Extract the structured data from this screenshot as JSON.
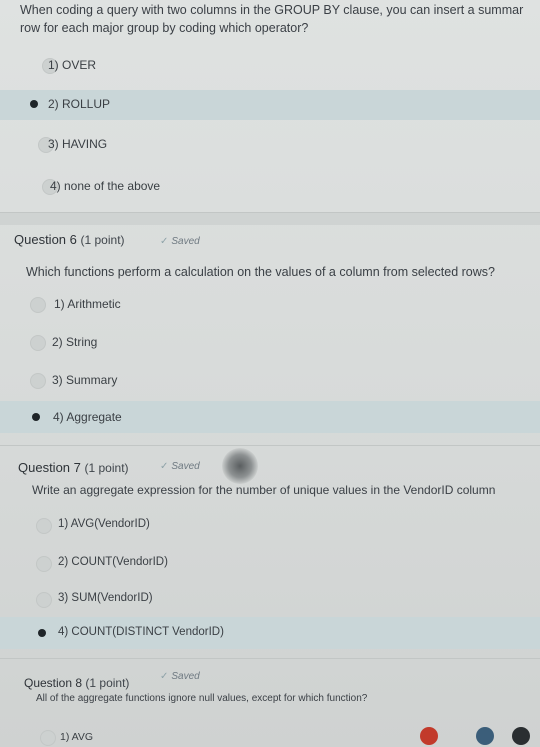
{
  "q5": {
    "question_line1": "When coding a query with two columns in the GROUP BY clause, you can insert a summar",
    "question_line2": "row for each major group by coding which operator?",
    "options": [
      "1) OVER",
      "2) ROLLUP",
      "3) HAVING",
      "4) none of the above"
    ],
    "selected_index": 1
  },
  "q6": {
    "title": "Question 6",
    "points": "(1 point)",
    "saved": "Saved",
    "question": "Which functions perform a calculation on the values of a column from selected rows?",
    "options": [
      "1) Arithmetic",
      "2) String",
      "3) Summary",
      "4) Aggregate"
    ],
    "selected_index": 3
  },
  "q7": {
    "title": "Question 7",
    "points": "(1 point)",
    "saved": "Saved",
    "question": "Write an aggregate expression for the number of unique values in the VendorID column",
    "options": [
      "1) AVG(VendorID)",
      "2) COUNT(VendorID)",
      "3) SUM(VendorID)",
      "4) COUNT(DISTINCT VendorID)"
    ],
    "selected_index": 3
  },
  "q8": {
    "title": "Question 8",
    "points": "(1 point)",
    "saved": "Saved",
    "question": "All of the aggregate functions ignore null values, except for which function?",
    "options": [
      "1) AVG"
    ]
  },
  "icons": {
    "checkmark": "checkmark-icon",
    "radio_selected": "radio-selected-icon",
    "radio_unselected": "radio-unselected-icon"
  },
  "colors": {
    "selected_row": "#c9d6d8",
    "background": "#d9dcdb",
    "text": "#3d4247"
  }
}
